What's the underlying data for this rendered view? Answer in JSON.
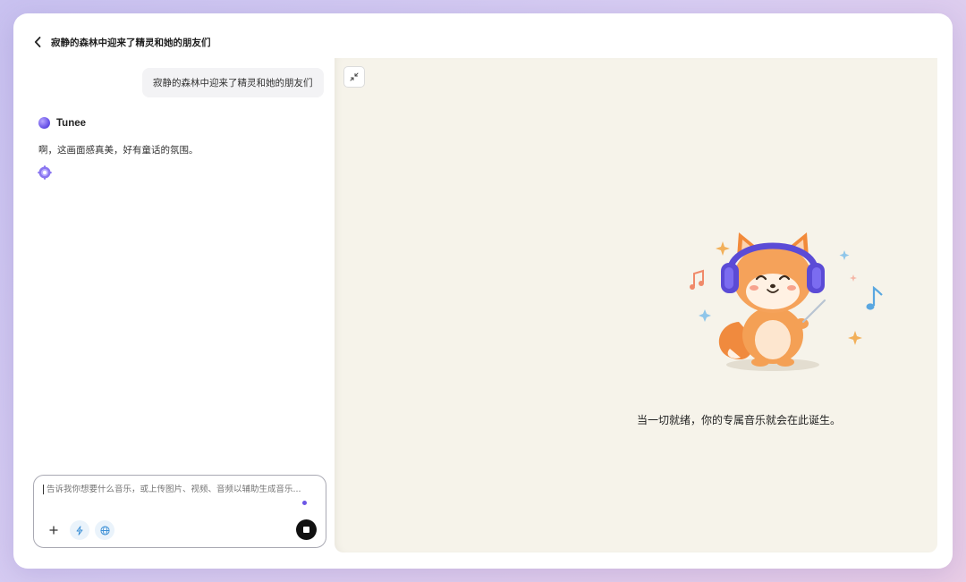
{
  "header": {
    "title": "寂静的森林中迎来了精灵和她的朋友们"
  },
  "chat": {
    "user_message": "寂静的森林中迎来了精灵和她的朋友们",
    "assistant_name": "Tunee",
    "assistant_message": "啊，这画面感真美，好有童话的氛围。"
  },
  "input": {
    "placeholder": "告诉我你想要什么音乐，或上传图片、视频、音频以辅助生成音乐...",
    "value": ""
  },
  "preview": {
    "empty_text": "当一切就绪，你的专属音乐就会在此诞生。"
  },
  "colors": {
    "accent": "#6b56e6",
    "panel_bg": "#f6f3ea",
    "stop_button": "#111111"
  },
  "icons": {
    "back": "chevron-left-icon",
    "loading": "gear-loading-icon",
    "plus": "plus-icon",
    "bolt": "lightning-icon",
    "globe": "globe-icon",
    "stop": "stop-icon",
    "collapse": "collapse-arrows-icon"
  }
}
